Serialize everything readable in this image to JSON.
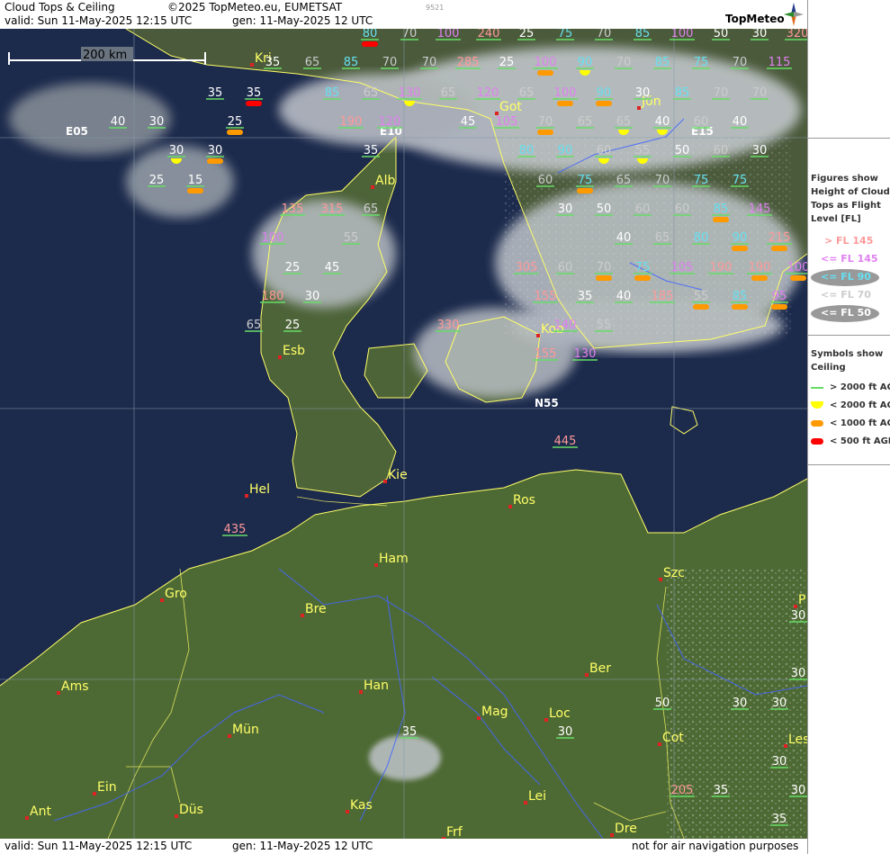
{
  "header": {
    "title": "Cloud Tops & Ceiling",
    "copyright": "©2025 TopMeteo.eu, EUMETSAT",
    "code": "9521",
    "valid": "valid:  Sun  11-May-2025  12:15 UTC",
    "gen": "gen: 11-May-2025 12 UTC",
    "logo": "TopMeteo"
  },
  "footer": {
    "valid": "valid:  Sun  11-May-2025  12:15 UTC",
    "gen": "gen: 11-May-2025 12 UTC",
    "disclaimer": "not for air navigation purposes"
  },
  "scale_bar": "200 km",
  "grid_labels": [
    "E05",
    "E10",
    "E15",
    "N55"
  ],
  "cities": [
    "Kri",
    "Got",
    "Jön",
    "Alb",
    "Esb",
    "Kob",
    "Hel",
    "Kie",
    "Ros",
    "Ham",
    "Szc",
    "Gro",
    "Bre",
    "Ams",
    "Han",
    "Ber",
    "Mün",
    "Mag",
    "Loc",
    "Cot",
    "Ein",
    "Kas",
    "Lei",
    "Ant",
    "Düs",
    "Frf",
    "Dre",
    "Les",
    "P"
  ],
  "colors": {
    "gt145": "#ff9999",
    "le145": "#e080f0",
    "le90": "#66e0f0",
    "le70": "#cccccc",
    "le50": "#ffffff",
    "ceil_gt2000": "#66dd66",
    "ceil_lt2000": "#ffff00",
    "ceil_lt1000": "#ff9900",
    "ceil_lt500": "#ff0000",
    "coast": "#ffff66",
    "river": "#4466ff"
  },
  "cloud_tops": [
    {
      "v": "80",
      "c": "le90",
      "s": "red"
    },
    {
      "v": "70",
      "c": "le70"
    },
    {
      "v": "100",
      "c": "le145"
    },
    {
      "v": "240",
      "c": "gt145"
    },
    {
      "v": "25",
      "c": "le50"
    },
    {
      "v": "75",
      "c": "le90"
    },
    {
      "v": "70",
      "c": "le70"
    },
    {
      "v": "85",
      "c": "le90"
    },
    {
      "v": "100",
      "c": "le145"
    },
    {
      "v": "50",
      "c": "le50"
    },
    {
      "v": "30",
      "c": "le50"
    },
    {
      "v": "320",
      "c": "gt145"
    },
    {
      "v": "35",
      "c": "le50"
    },
    {
      "v": "65",
      "c": "le70"
    },
    {
      "v": "85",
      "c": "le90"
    },
    {
      "v": "70",
      "c": "le70"
    },
    {
      "v": "70",
      "c": "le70"
    },
    {
      "v": "285",
      "c": "gt145"
    },
    {
      "v": "25",
      "c": "le50"
    },
    {
      "v": "100",
      "c": "le145",
      "s": "orange"
    },
    {
      "v": "90",
      "c": "le90",
      "s": "yellow"
    },
    {
      "v": "70",
      "c": "le70"
    },
    {
      "v": "85",
      "c": "le90"
    },
    {
      "v": "75",
      "c": "le90"
    },
    {
      "v": "70",
      "c": "le70"
    },
    {
      "v": "115",
      "c": "le145"
    },
    {
      "v": "35",
      "c": "le50"
    },
    {
      "v": "35",
      "c": "le50",
      "s": "red"
    },
    {
      "v": "85",
      "c": "le90"
    },
    {
      "v": "65",
      "c": "le70"
    },
    {
      "v": "130",
      "c": "le145",
      "s": "yellow"
    },
    {
      "v": "65",
      "c": "le70"
    },
    {
      "v": "120",
      "c": "le145"
    },
    {
      "v": "65",
      "c": "le70"
    },
    {
      "v": "100",
      "c": "le145",
      "s": "orange"
    },
    {
      "v": "90",
      "c": "le90",
      "s": "orange"
    },
    {
      "v": "30",
      "c": "le50"
    },
    {
      "v": "85",
      "c": "le90"
    },
    {
      "v": "70",
      "c": "le70"
    },
    {
      "v": "70",
      "c": "le70"
    },
    {
      "v": "40",
      "c": "le50"
    },
    {
      "v": "30",
      "c": "le50"
    },
    {
      "v": "25",
      "c": "le50",
      "s": "orange"
    },
    {
      "v": "190",
      "c": "gt145"
    },
    {
      "v": "120",
      "c": "le145"
    },
    {
      "v": "45",
      "c": "le50"
    },
    {
      "v": "105",
      "c": "le145"
    },
    {
      "v": "70",
      "c": "le70",
      "s": "orange"
    },
    {
      "v": "65",
      "c": "le70"
    },
    {
      "v": "65",
      "c": "le70",
      "s": "yellow"
    },
    {
      "v": "40",
      "c": "le50",
      "s": "yellow"
    },
    {
      "v": "60",
      "c": "le70"
    },
    {
      "v": "40",
      "c": "le50"
    },
    {
      "v": "30",
      "c": "le50",
      "s": "yellow"
    },
    {
      "v": "30",
      "c": "le50",
      "s": "orange"
    },
    {
      "v": "35",
      "c": "le50"
    },
    {
      "v": "80",
      "c": "le90"
    },
    {
      "v": "90",
      "c": "le90"
    },
    {
      "v": "60",
      "c": "le70",
      "s": "yellow"
    },
    {
      "v": "55",
      "c": "le70",
      "s": "yellow"
    },
    {
      "v": "50",
      "c": "le50"
    },
    {
      "v": "60",
      "c": "le70"
    },
    {
      "v": "30",
      "c": "le50"
    },
    {
      "v": "25",
      "c": "le50"
    },
    {
      "v": "15",
      "c": "le50",
      "s": "orange"
    },
    {
      "v": "60",
      "c": "le70"
    },
    {
      "v": "75",
      "c": "le90",
      "s": "orange"
    },
    {
      "v": "65",
      "c": "le70"
    },
    {
      "v": "70",
      "c": "le70"
    },
    {
      "v": "75",
      "c": "le90"
    },
    {
      "v": "75",
      "c": "le90"
    },
    {
      "v": "135",
      "c": "gt145"
    },
    {
      "v": "315",
      "c": "gt145"
    },
    {
      "v": "65",
      "c": "le70"
    },
    {
      "v": "30",
      "c": "le50"
    },
    {
      "v": "50",
      "c": "le50"
    },
    {
      "v": "60",
      "c": "le70"
    },
    {
      "v": "60",
      "c": "le70"
    },
    {
      "v": "85",
      "c": "le90",
      "s": "orange"
    },
    {
      "v": "145",
      "c": "le145"
    },
    {
      "v": "100",
      "c": "le145"
    },
    {
      "v": "55",
      "c": "le70"
    },
    {
      "v": "40",
      "c": "le50"
    },
    {
      "v": "65",
      "c": "le70"
    },
    {
      "v": "80",
      "c": "le90"
    },
    {
      "v": "90",
      "c": "le90",
      "s": "orange"
    },
    {
      "v": "215",
      "c": "gt145",
      "s": "orange"
    },
    {
      "v": "25",
      "c": "le50"
    },
    {
      "v": "45",
      "c": "le50"
    },
    {
      "v": "305",
      "c": "gt145"
    },
    {
      "v": "60",
      "c": "le70"
    },
    {
      "v": "70",
      "c": "le70",
      "s": "orange"
    },
    {
      "v": "75",
      "c": "le90",
      "s": "orange"
    },
    {
      "v": "105",
      "c": "le145"
    },
    {
      "v": "190",
      "c": "gt145"
    },
    {
      "v": "190",
      "c": "gt145",
      "s": "orange"
    },
    {
      "v": "100",
      "c": "le145",
      "s": "orange"
    },
    {
      "v": "180",
      "c": "gt145"
    },
    {
      "v": "30",
      "c": "le50"
    },
    {
      "v": "155",
      "c": "gt145"
    },
    {
      "v": "35",
      "c": "le50"
    },
    {
      "v": "40",
      "c": "le50"
    },
    {
      "v": "185",
      "c": "gt145"
    },
    {
      "v": "55",
      "c": "le70",
      "s": "orange"
    },
    {
      "v": "85",
      "c": "le90",
      "s": "orange"
    },
    {
      "v": "95",
      "c": "le145",
      "s": "orange"
    },
    {
      "v": "65",
      "c": "le70"
    },
    {
      "v": "25",
      "c": "le50"
    },
    {
      "v": "330",
      "c": "gt145"
    },
    {
      "v": "140",
      "c": "le145"
    },
    {
      "v": "55",
      "c": "le70"
    },
    {
      "v": "155",
      "c": "gt145"
    },
    {
      "v": "130",
      "c": "le145"
    },
    {
      "v": "445",
      "c": "gt145"
    },
    {
      "v": "435",
      "c": "gt145"
    },
    {
      "v": "30",
      "c": "le50"
    },
    {
      "v": "30",
      "c": "le50"
    },
    {
      "v": "50",
      "c": "le50"
    },
    {
      "v": "30",
      "c": "le50"
    },
    {
      "v": "30",
      "c": "le50"
    },
    {
      "v": "35",
      "c": "le50"
    },
    {
      "v": "30",
      "c": "le50"
    },
    {
      "v": "30",
      "c": "le50"
    },
    {
      "v": "205",
      "c": "gt145"
    },
    {
      "v": "35",
      "c": "le50"
    },
    {
      "v": "30",
      "c": "le50"
    },
    {
      "v": "35",
      "c": "le50"
    }
  ],
  "legend": {
    "heading": [
      "Figures show",
      "Height of Cloud",
      "Tops as Flight",
      "Level  [FL]"
    ],
    "levels": [
      "> FL 145",
      "<= FL 145",
      "<= FL 90",
      "<= FL 70",
      "<= FL 50"
    ],
    "symbols_heading": [
      "Symbols show",
      "Ceiling"
    ],
    "symbols": [
      "> 2000 ft AGL",
      "< 2000 ft AGL",
      "< 1000 ft AGL",
      "< 500 ft AGL"
    ]
  }
}
